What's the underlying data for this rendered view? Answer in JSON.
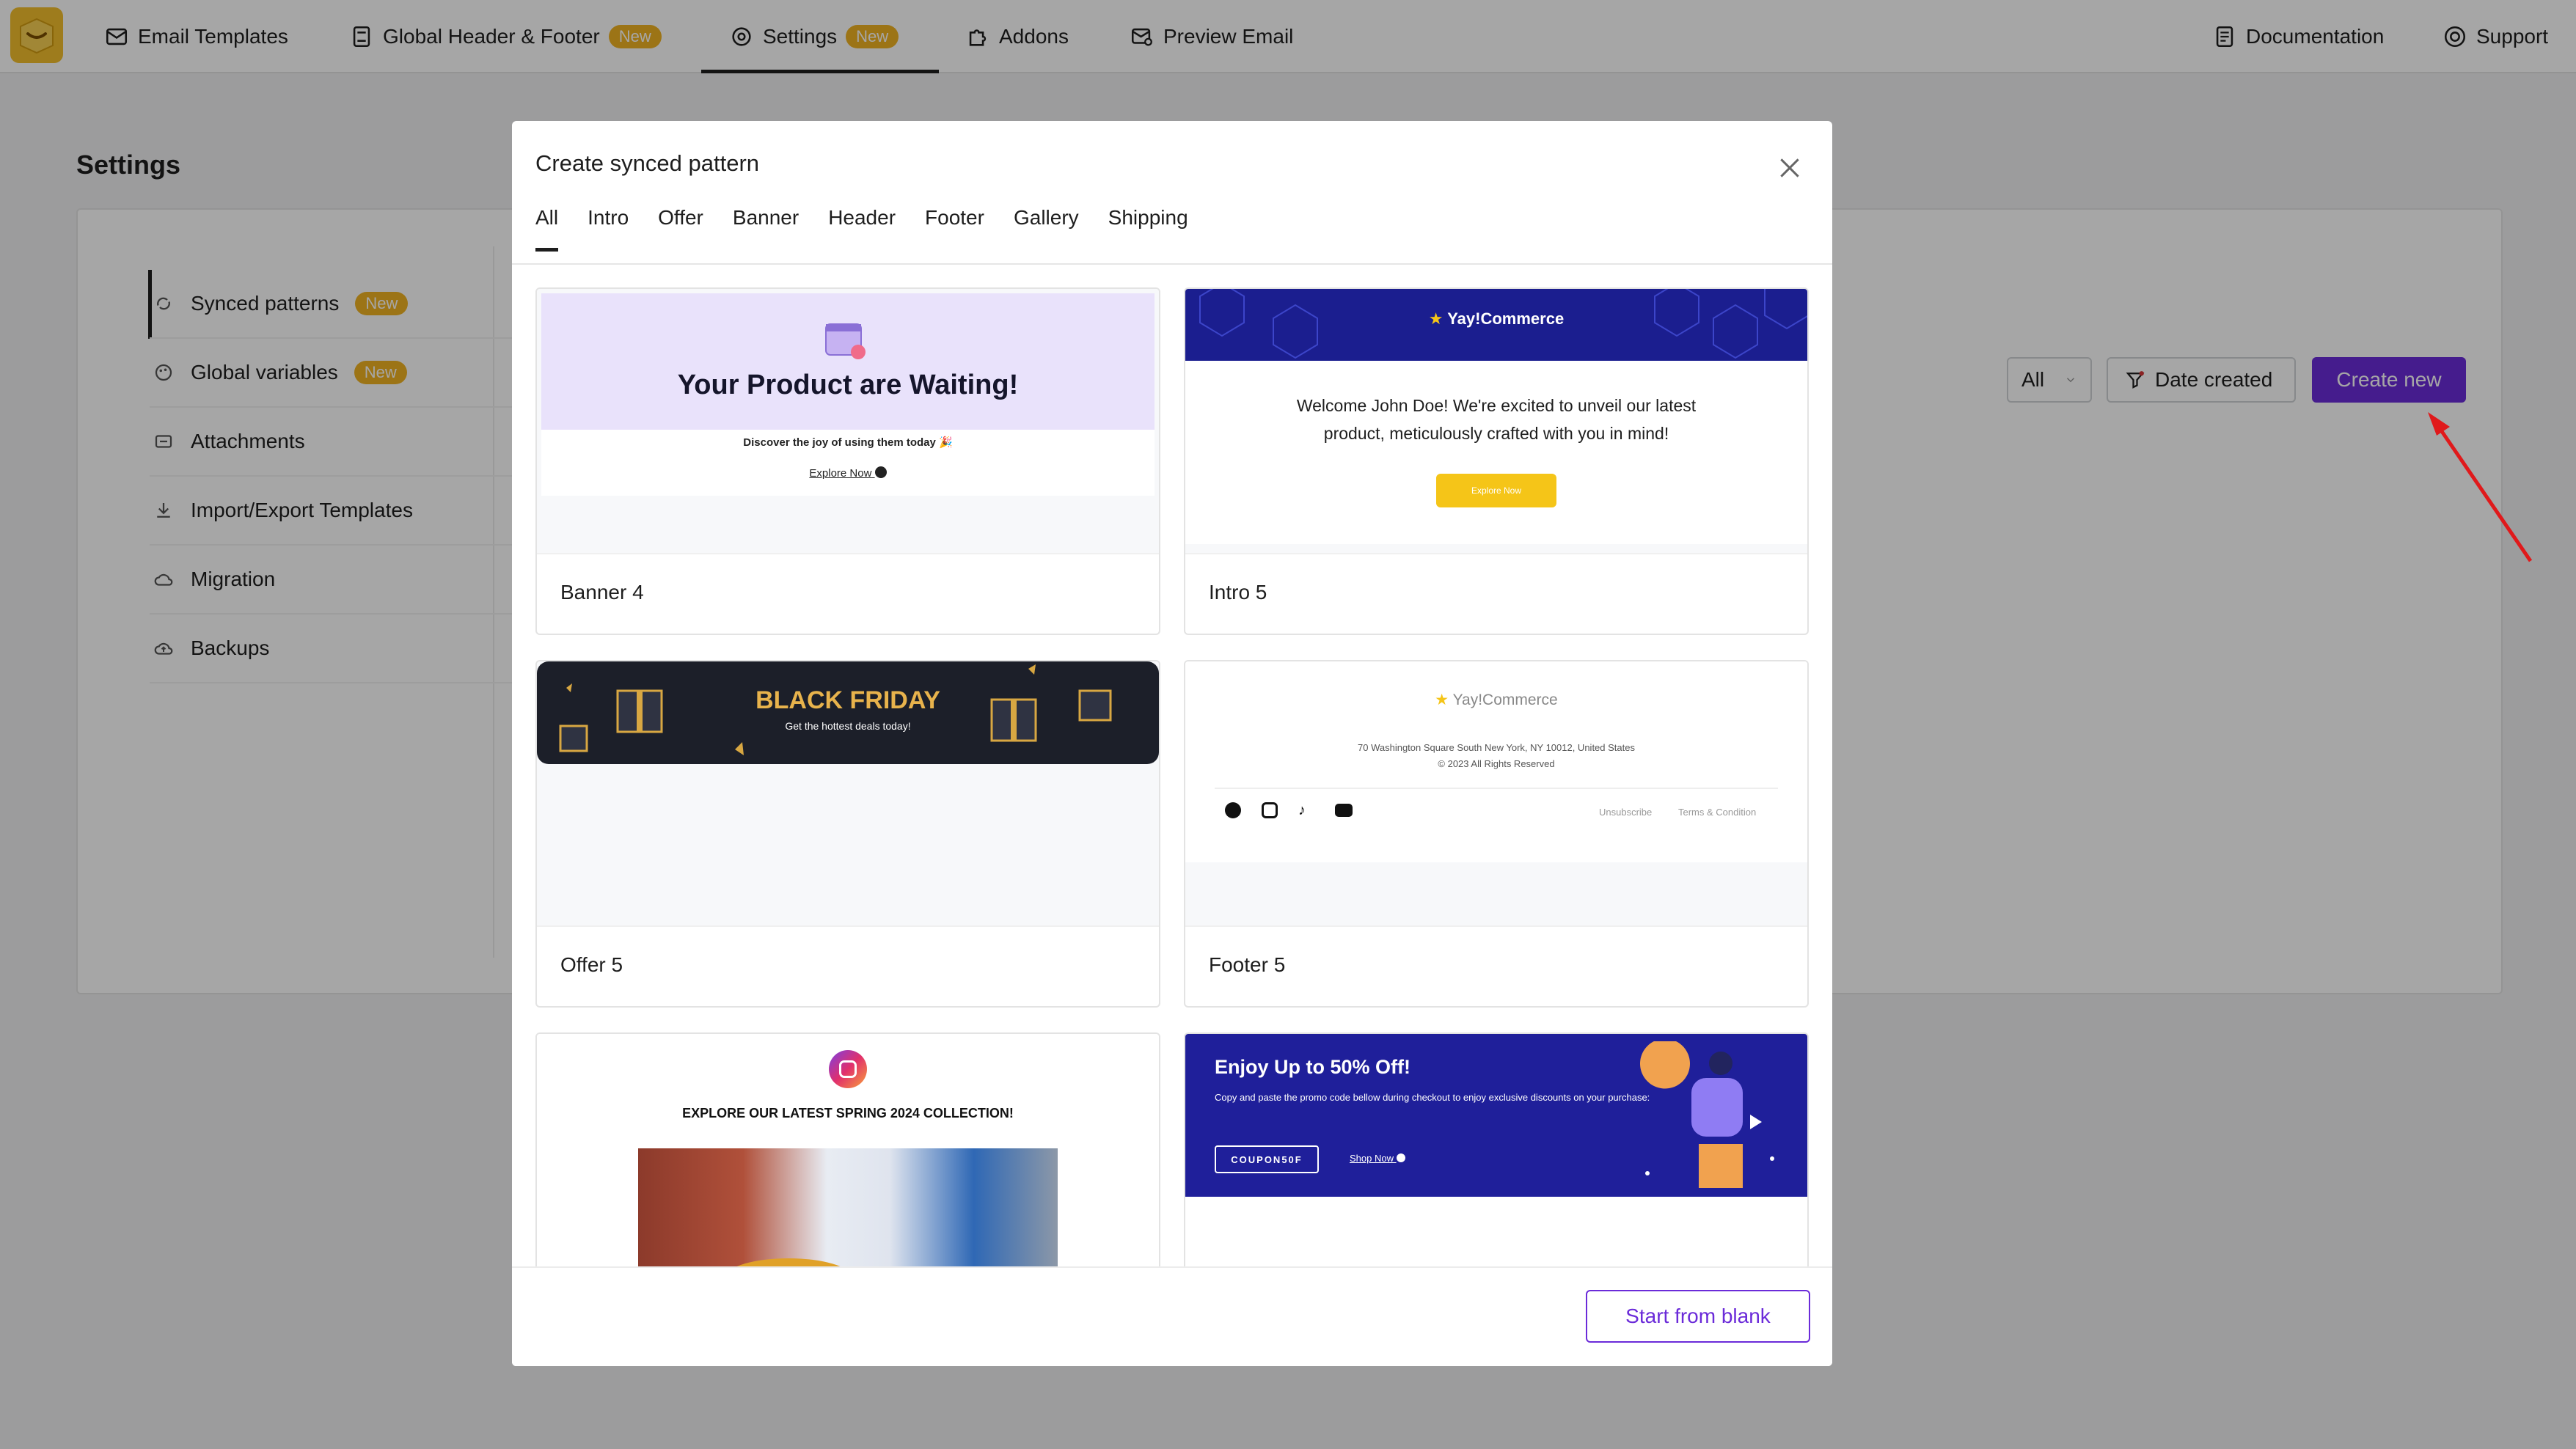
{
  "topnav": {
    "items": [
      {
        "label": "Email Templates",
        "icon": "email-template-icon"
      },
      {
        "label": "Global Header & Footer",
        "icon": "layout-icon",
        "badge": "New"
      },
      {
        "label": "Settings",
        "icon": "settings-icon",
        "badge": "New",
        "active": true
      },
      {
        "label": "Addons",
        "icon": "puzzle-icon"
      },
      {
        "label": "Preview Email",
        "icon": "preview-email-icon"
      }
    ],
    "right": [
      {
        "label": "Documentation",
        "icon": "document-icon"
      },
      {
        "label": "Support",
        "icon": "lifebuoy-icon"
      }
    ]
  },
  "page": {
    "title": "Settings"
  },
  "sidebar": {
    "items": [
      {
        "label": "Synced patterns",
        "badge": "New",
        "icon": "sync-icon"
      },
      {
        "label": "Global variables",
        "badge": "New",
        "icon": "palette-icon"
      },
      {
        "label": "Attachments",
        "icon": "attachment-icon"
      },
      {
        "label": "Import/Export Templates",
        "icon": "download-icon"
      },
      {
        "label": "Migration",
        "icon": "cloud-sync-icon"
      },
      {
        "label": "Backups",
        "icon": "cloud-upload-icon"
      }
    ]
  },
  "toolbar": {
    "filter_value": "All",
    "date_label": "Date created",
    "create_label": "Create new"
  },
  "modal": {
    "title": "Create synced pattern",
    "tabs": [
      "All",
      "Intro",
      "Offer",
      "Banner",
      "Header",
      "Footer",
      "Gallery",
      "Shipping"
    ],
    "active_tab": "All",
    "footer_button": "Start from blank",
    "cards": [
      {
        "label": "Banner 4",
        "preview": {
          "headline": "Your Product are Waiting!",
          "subtext": "Discover the joy of using them today 🎉",
          "link": "Explore Now"
        }
      },
      {
        "label": "Intro 5",
        "preview": {
          "brand": "Yay!Commerce",
          "body": "Welcome John Doe! We're excited to unveil our latest product, meticulously crafted with you in mind!",
          "button": "Explore Now"
        }
      },
      {
        "label": "Offer 5",
        "preview": {
          "headline": "BLACK FRIDAY",
          "subtext": "Get the hottest deals today!"
        }
      },
      {
        "label": "Footer 5",
        "preview": {
          "brand": "Yay!Commerce",
          "address": "70 Washington Square South New York, NY 10012, United States",
          "copyright": "© 2023 All Rights Reserved",
          "links": [
            "Unsubscribe",
            "Terms & Condition"
          ]
        }
      },
      {
        "label": "",
        "preview": {
          "headline": "EXPLORE OUR LATEST SPRING 2024 COLLECTION!"
        }
      },
      {
        "label": "",
        "preview": {
          "headline": "Enjoy Up to 50% Off!",
          "body": "Copy and paste the promo code bellow during checkout to enjoy exclusive discounts on your purchase:",
          "code": "COUPON50F",
          "link": "Shop Now"
        }
      }
    ]
  },
  "colors": {
    "accent": "#6b2bd9",
    "badge": "#f0b323",
    "logo": "#f3bf2d"
  }
}
